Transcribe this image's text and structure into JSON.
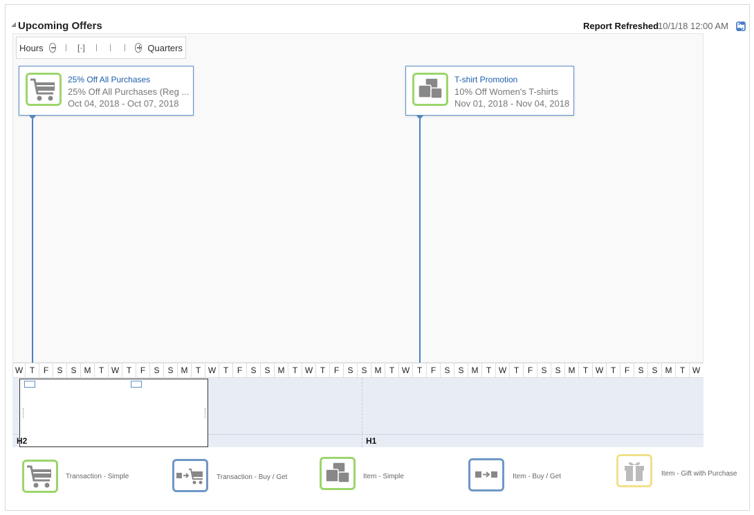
{
  "header": {
    "title": "Upcoming Offers",
    "refreshed_label": "Report Refreshed",
    "refreshed_value": "10/1/18 12:00 AM"
  },
  "zoom": {
    "min_label": "Hours",
    "fit_label": "[·]",
    "max_label": "Quarters"
  },
  "offers": [
    {
      "title": "25% Off All Purchases",
      "subtitle": "25% Off All Purchases (Reg ...",
      "dates": "Oct 04, 2018 - Oct 07, 2018",
      "type_icon": "cart-icon"
    },
    {
      "title": "T-shirt Promotion",
      "subtitle": "10% Off Women's T-shirts",
      "dates": "Nov 01, 2018 - Nov 04, 2018",
      "type_icon": "item-icon"
    }
  ],
  "days": [
    "W",
    "T",
    "F",
    "S",
    "S",
    "M",
    "T",
    "W",
    "T",
    "F",
    "S",
    "S",
    "M",
    "T",
    "W",
    "T",
    "F",
    "S",
    "S",
    "M",
    "T",
    "W",
    "T",
    "F",
    "S",
    "S",
    "M",
    "T",
    "W",
    "T",
    "F",
    "S",
    "S",
    "M",
    "T",
    "W",
    "T",
    "F",
    "S",
    "S",
    "M",
    "T",
    "W",
    "T",
    "F",
    "S",
    "S",
    "M",
    "T",
    "W"
  ],
  "overview": {
    "period_labels": [
      "H2",
      "H1"
    ]
  },
  "legend": [
    {
      "label": "Transaction - Simple",
      "icon": "cart-icon",
      "color": "#9cd56b"
    },
    {
      "label": "Transaction - Buy / Get",
      "icon": "buy-get-cart-icon",
      "color": "#6f97c6"
    },
    {
      "label": "Item - Simple",
      "icon": "item-icon",
      "color": "#9cd56b"
    },
    {
      "label": "Item - Buy / Get",
      "icon": "buy-get-item-icon",
      "color": "#6f97c6"
    },
    {
      "label": "Item - Gift with Purchase",
      "icon": "gift-icon",
      "color": "#f1e08a"
    }
  ],
  "colors": {
    "accent": "#1c5ea8",
    "card_border": "#5b8fc9",
    "green": "#9cd56b"
  }
}
